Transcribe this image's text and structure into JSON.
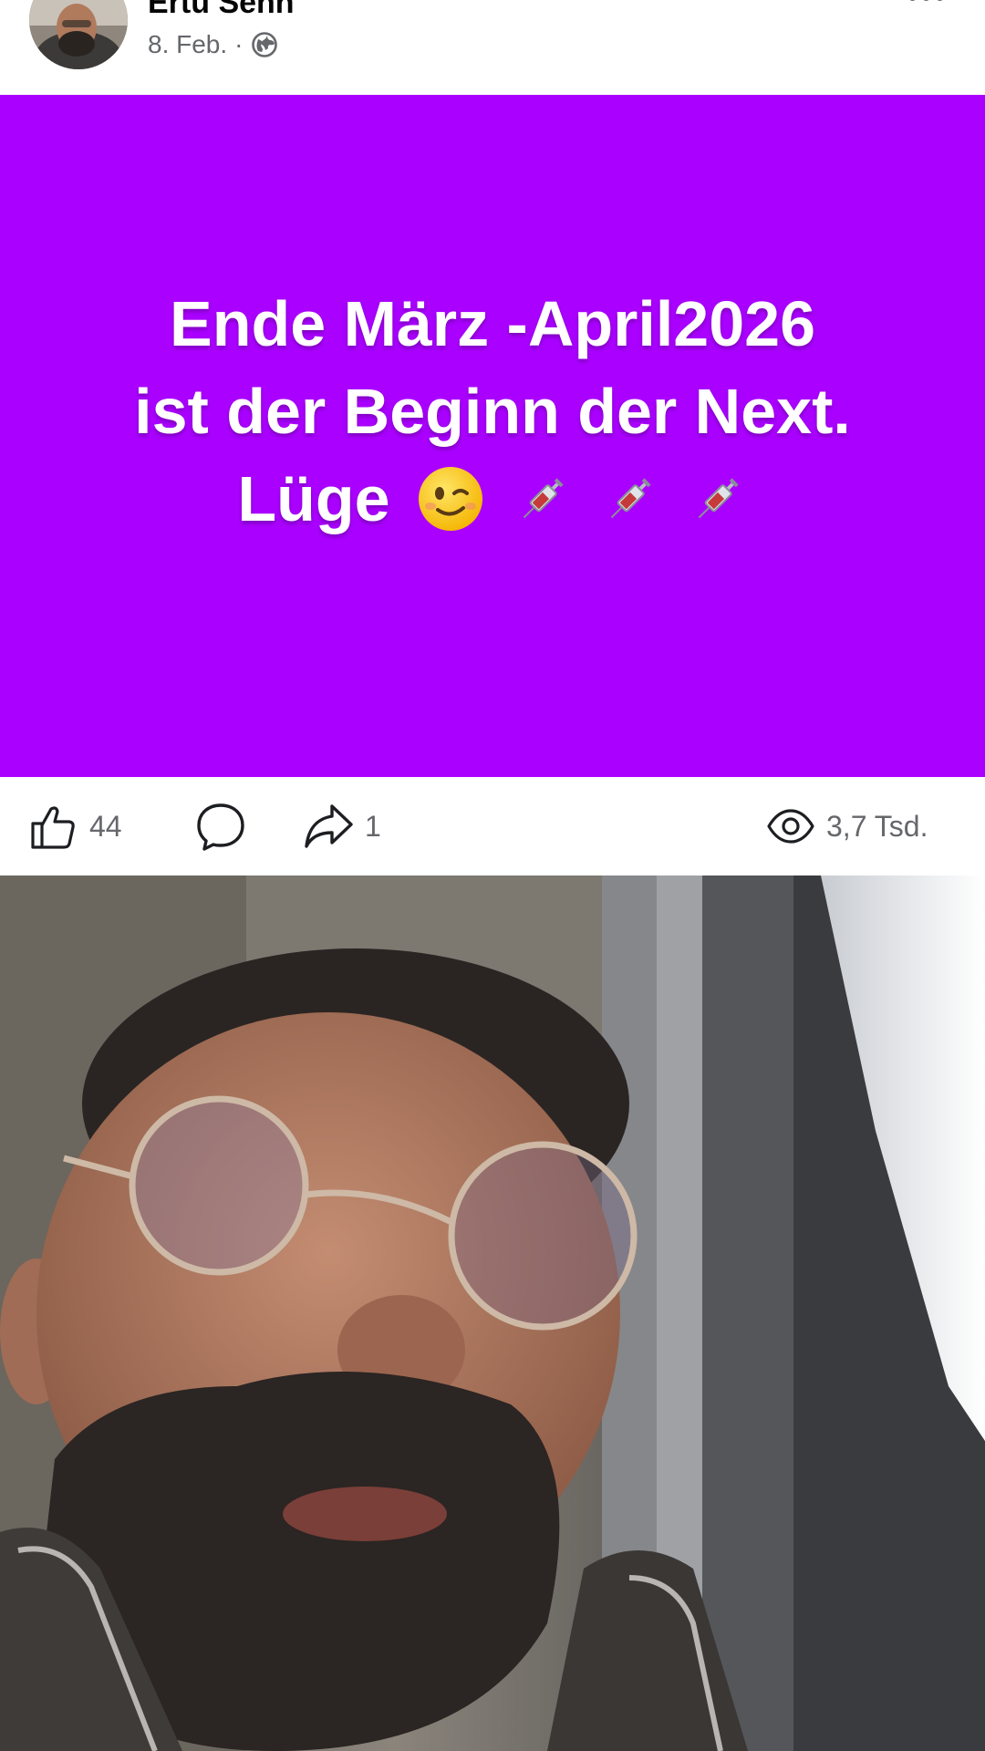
{
  "post": {
    "author_name": "Ertu Sehn",
    "date": "8. Feb.",
    "separator": "·",
    "privacy_icon": "globe-icon",
    "more_icon": "more-horizontal-icon"
  },
  "text_card": {
    "background_color": "#aa00ff",
    "line1": "Ende März -April2026",
    "line2": "ist der Beginn der Next.",
    "line3": "Lüge",
    "emojis": [
      "winking-face-emoji",
      "syringe-emoji",
      "syringe-emoji",
      "syringe-emoji"
    ]
  },
  "reactions": {
    "likes": "44",
    "shares": "1",
    "views": "3,7 Tsd.",
    "like_icon": "thumbs-up-icon",
    "comment_icon": "comment-icon",
    "share_icon": "share-arrow-icon",
    "views_icon": "eye-icon"
  },
  "video_post": {
    "thumbnail": "selfie-video-thumbnail"
  }
}
